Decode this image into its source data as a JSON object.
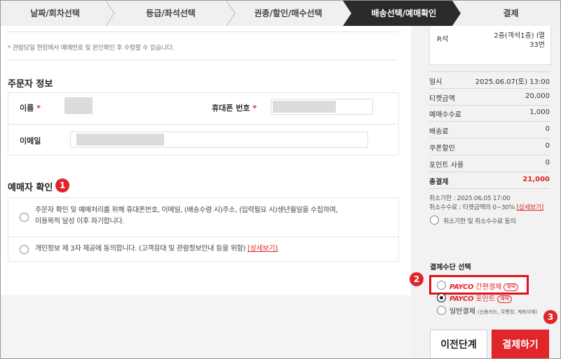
{
  "steps": [
    {
      "label": "날짜/회차선택",
      "active": false
    },
    {
      "label": "등급/좌석선택",
      "active": false
    },
    {
      "label": "권종/할인/매수선택",
      "active": false
    },
    {
      "label": "배송선택/예매확인",
      "active": true
    },
    {
      "label": "결제",
      "active": false
    }
  ],
  "colors": {
    "accent": "#e0262b",
    "active_step": "#2b2b2b",
    "step_bg": "#f0f0f0"
  },
  "left": {
    "note": "* 관람당일 현장에서 예매번호 및 본인확인 후 수령할 수 있습니다.",
    "orderer": {
      "title": "주문자 정보",
      "name_label": "이름",
      "phone_label": "휴대폰 번호",
      "email_label": "이메일",
      "required_mark": "*"
    },
    "confirm": {
      "title": "예매자 확인",
      "badge": "1",
      "agree1_line1": "주문자 확인 및 예매처리를 위해 휴대폰번호, 이메일, (배송수령 시)주소, (입력필요 시)생년월일을 수집하며,",
      "agree1_line2": "이용목적 달성 이후 파기합니다.",
      "agree2_text": "개인정보 제 3자 제공에 동의합니다. (고객응대 및 관람정보안내 등을 위함)",
      "agree2_link": "[상세보기]"
    }
  },
  "right": {
    "seat": {
      "grade": "R석",
      "info_line1": "2층(객석1층) I열",
      "info_line2": "33번"
    },
    "summary": [
      {
        "label": "일시",
        "value": "2025.06.07(토) 13:00"
      },
      {
        "label": "티켓금액",
        "value": "20,000"
      },
      {
        "label": "예매수수료",
        "value": "1,000"
      },
      {
        "label": "배송료",
        "value": "0"
      },
      {
        "label": "쿠폰할인",
        "value": "0"
      },
      {
        "label": "포인트 사용",
        "value": "0"
      }
    ],
    "total": {
      "label": "총결제",
      "value": "21,000"
    },
    "cancel_deadline": "취소기한 : 2025.06.05 17:00",
    "cancel_fee": "취소수수료 : 티켓금액의 0~30%",
    "cancel_fee_link": "[상세보기]",
    "cancel_agree": "취소기한 및 취소수수료 동의",
    "pay_title": "결제수단 선택",
    "pay_options": [
      {
        "brand": "PAYCO",
        "label": "간편결제",
        "pill": "혜택"
      },
      {
        "brand": "PAYCO",
        "label": "포인트",
        "pill": "혜택"
      },
      {
        "label": "일반결제",
        "sub": "(신용카드, 무통장, 계좌이체)"
      }
    ],
    "badge2": "2",
    "badge3": "3",
    "btn_prev": "이전단계",
    "btn_pay": "결제하기"
  }
}
